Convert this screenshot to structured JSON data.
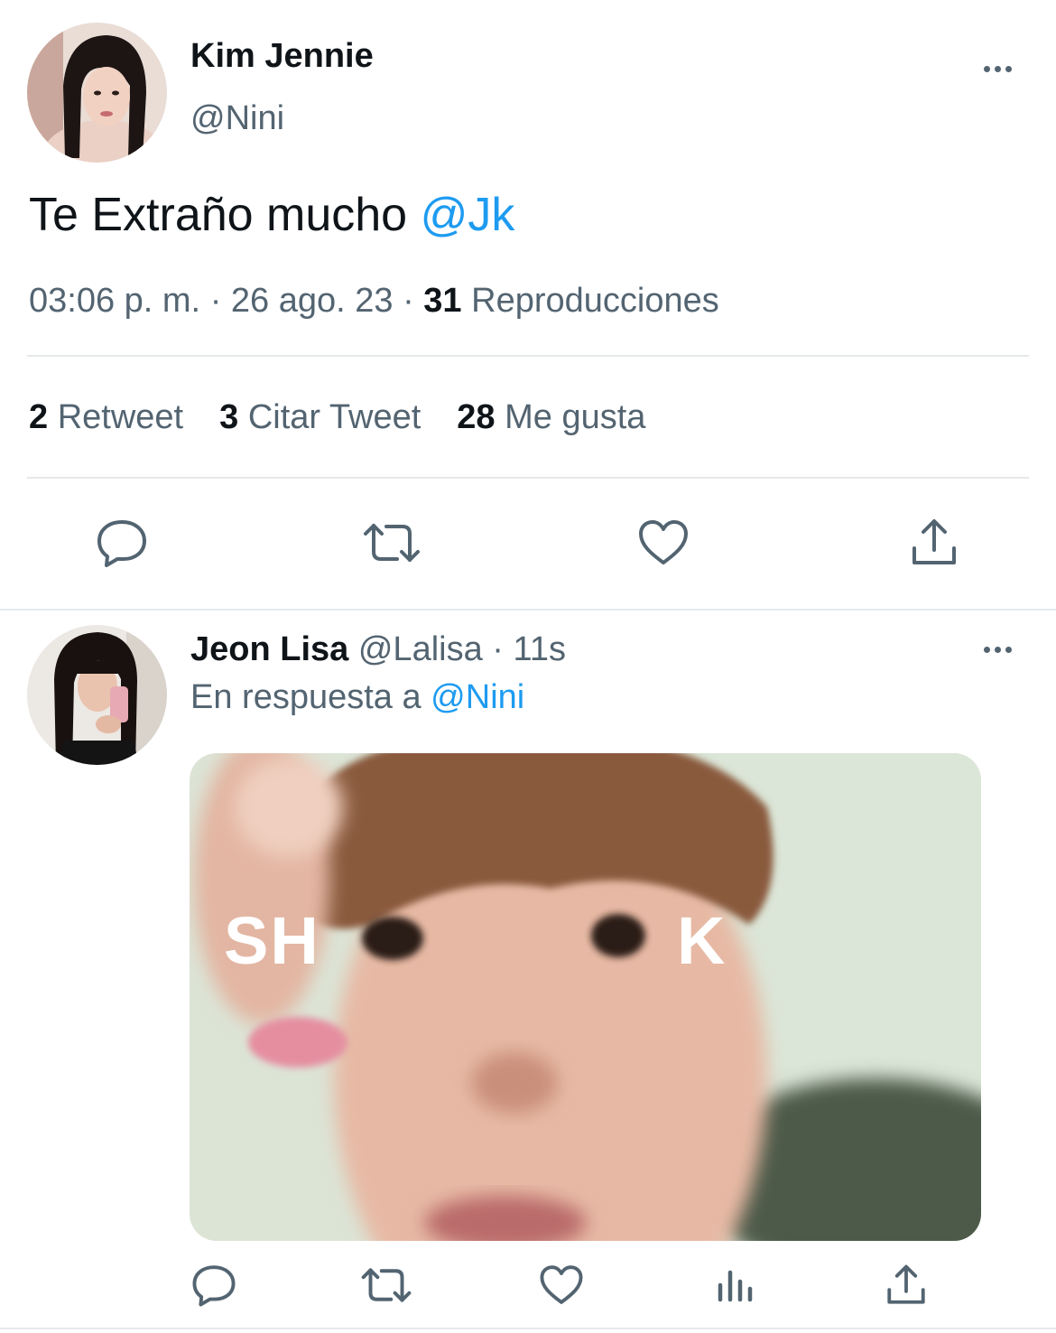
{
  "tweet": {
    "author_name": "Kim Jennie",
    "author_handle": "@Nini",
    "text": "Te Extraño mucho",
    "mention": "@Jk",
    "time": "03:06 p. m.",
    "date": "26 ago. 23",
    "views_count": "31",
    "views_label": "Reproducciones",
    "separator": "·",
    "stats": [
      {
        "count": "2",
        "label": "Retweet"
      },
      {
        "count": "3",
        "label": "Citar Tweet"
      },
      {
        "count": "28",
        "label": "Me gusta"
      }
    ],
    "actions": [
      "reply-icon",
      "retweet-icon",
      "like-icon",
      "share-icon"
    ]
  },
  "reply": {
    "author_name": "Jeon Lisa",
    "author_handle": "@Lalisa",
    "separator": "·",
    "time_ago": "11s",
    "replying_label": "En respuesta a",
    "replying_to": "@Nini",
    "media_caption_left": "SH",
    "media_caption_right": "K",
    "actions": [
      "reply-icon",
      "retweet-icon",
      "like-icon",
      "views-icon",
      "share-icon"
    ]
  },
  "colors": {
    "text": "#0f1419",
    "muted": "#536471",
    "link": "#1d9bf0",
    "divider": "#e6e9ec"
  }
}
